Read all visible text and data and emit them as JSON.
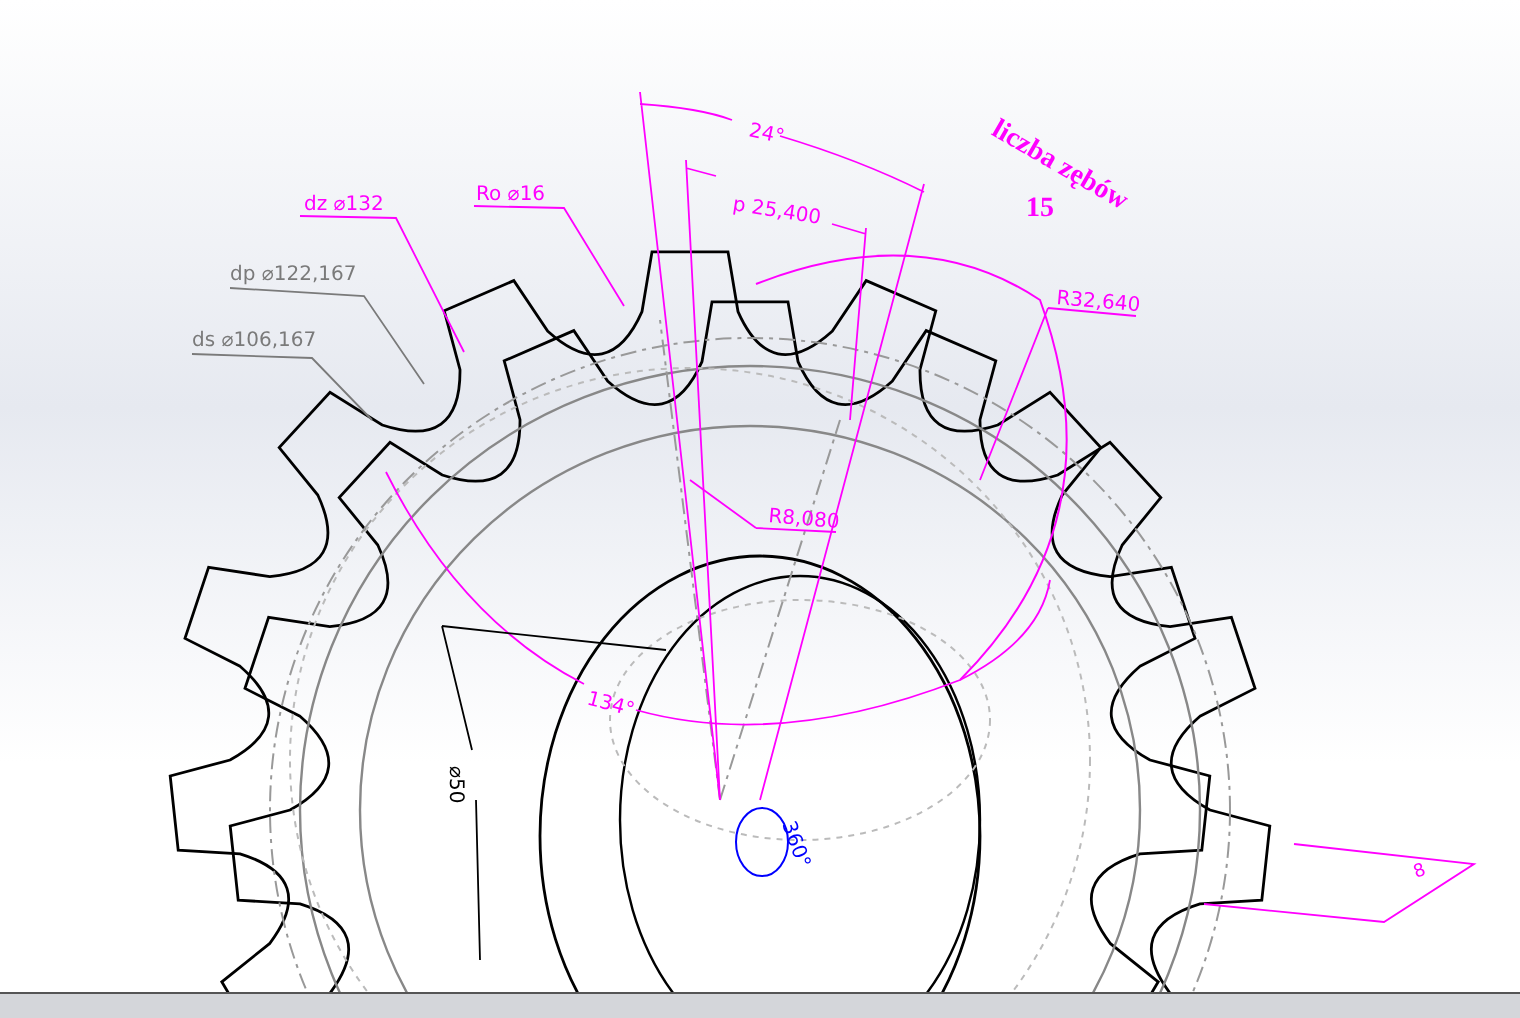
{
  "annotations": [
    {
      "kind": "angle",
      "text": "24°",
      "color": "#ff00ff"
    },
    {
      "kind": "note",
      "text": "liczba zębów",
      "color": "#ff00ff"
    },
    {
      "kind": "diameter",
      "text": "dz ⌀132",
      "color": "#ff00ff"
    },
    {
      "kind": "diameter",
      "text": "Ro ⌀16",
      "color": "#ff00ff"
    },
    {
      "kind": "pitch",
      "text": "p 25,400",
      "color": "#ff00ff"
    },
    {
      "kind": "note",
      "text": "15",
      "color": "#ff00ff"
    },
    {
      "kind": "diameter",
      "text": "dp ⌀122,167",
      "color": "#7a7a7a"
    },
    {
      "kind": "radius",
      "text": "R32,640",
      "color": "#ff00ff"
    },
    {
      "kind": "diameter",
      "text": "ds ⌀106,167",
      "color": "#7a7a7a"
    },
    {
      "kind": "radius",
      "text": "R8,080",
      "color": "#ff00ff"
    },
    {
      "kind": "angle",
      "text": "134°",
      "color": "#ff00ff"
    },
    {
      "kind": "diameter",
      "text": "⌀50",
      "color": "#000000"
    },
    {
      "kind": "angle",
      "text": "360°",
      "color": "#0000ff"
    },
    {
      "kind": "angle",
      "text": "8",
      "color": "#ff00ff"
    }
  ]
}
